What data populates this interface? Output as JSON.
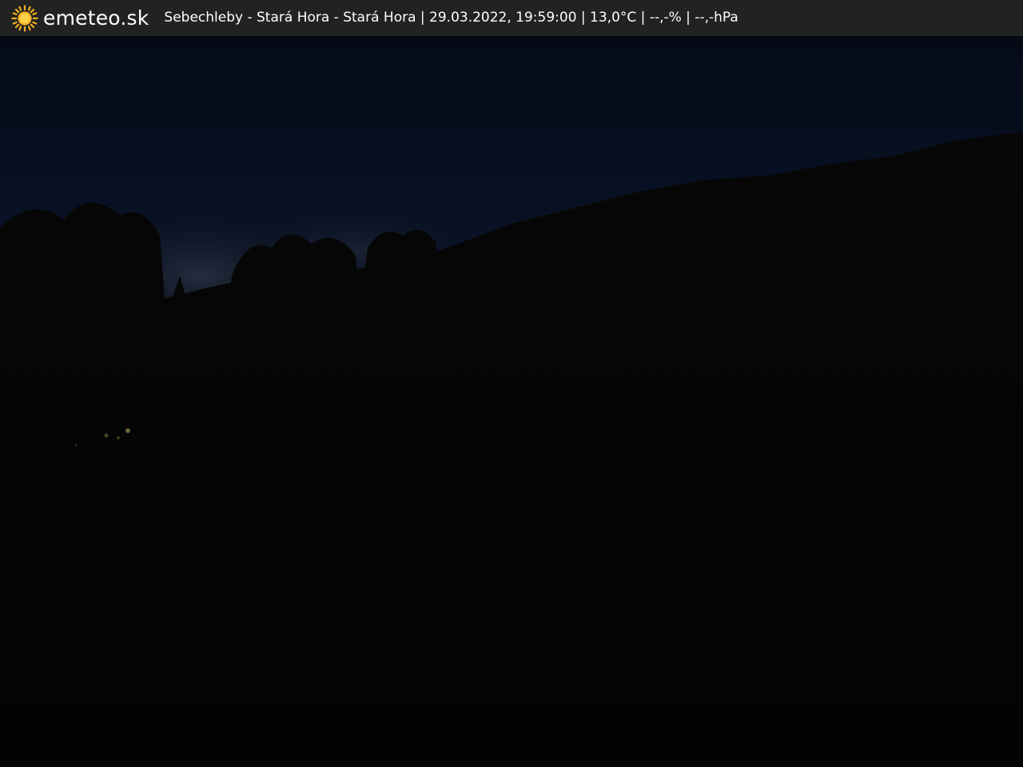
{
  "header": {
    "logo_icon": "sun-icon",
    "brand": "emeteo.sk",
    "caption": "Sebechleby - Stará Hora - Stará Hora | 29.03.2022, 19:59:00 | 13,0°C | --,-% | --,-hPa"
  },
  "colors": {
    "bar_background": "#222222",
    "bar_text": "#ffffff",
    "sun_accent": "#f5b21c"
  }
}
